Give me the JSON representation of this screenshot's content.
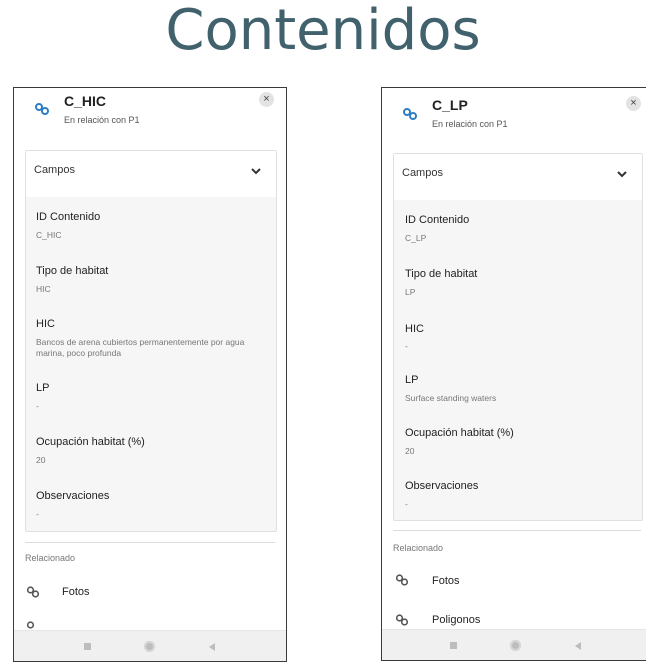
{
  "title": "Contenidos",
  "colors": {
    "accent": "#2d7ec4",
    "title": "#41626d"
  },
  "left": {
    "name": "C_HIC",
    "relation": "En relación con P1",
    "close_icon": "×",
    "section": "Campos",
    "fields": [
      {
        "label": "ID Contenido",
        "value": "C_HIC"
      },
      {
        "label": "Tipo de habitat",
        "value": "HIC"
      },
      {
        "label": "HIC",
        "value": "Bancos de arena cubiertos permanentemente por agua marina, poco profunda"
      },
      {
        "label": "LP",
        "value": "-"
      },
      {
        "label": "Ocupación habitat (%)",
        "value": "20"
      },
      {
        "label": "Observaciones",
        "value": "-"
      }
    ],
    "related_label": "Relacionado",
    "related": [
      {
        "label": "Fotos",
        "icon": "link-icon"
      }
    ]
  },
  "right": {
    "name": "C_LP",
    "relation": "En relación con P1",
    "close_icon": "×",
    "section": "Campos",
    "fields": [
      {
        "label": "ID Contenido",
        "value": "C_LP"
      },
      {
        "label": "Tipo de habitat",
        "value": "LP"
      },
      {
        "label": "HIC",
        "value": "-"
      },
      {
        "label": "LP",
        "value": "Surface standing waters"
      },
      {
        "label": "Ocupación habitat (%)",
        "value": "20"
      },
      {
        "label": "Observaciones",
        "value": "-"
      }
    ],
    "related_label": "Relacionado",
    "related": [
      {
        "label": "Fotos",
        "icon": "link-icon"
      },
      {
        "label": "Poligonos",
        "icon": "link-icon"
      }
    ]
  }
}
